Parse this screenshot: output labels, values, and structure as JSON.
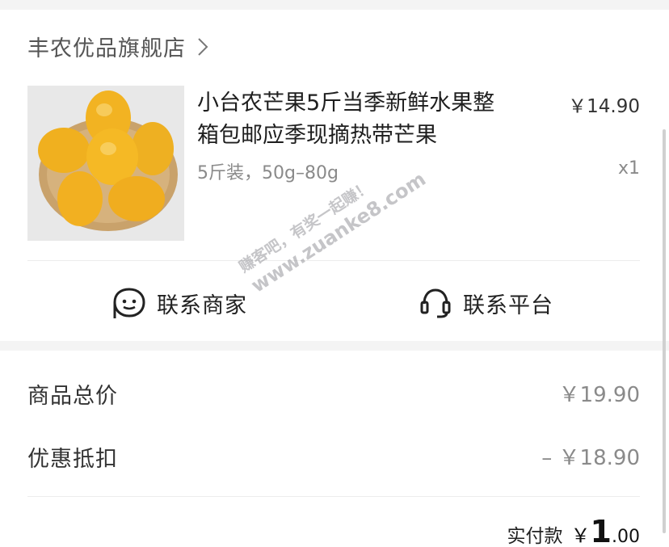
{
  "store": {
    "name": "丰农优品旗舰店"
  },
  "product": {
    "image": "mango-product-photo",
    "title_line1": "小台农芒果5斤当季新鲜水果整",
    "title_line2": "箱包邮应季现摘热带芒果",
    "spec": "5斤装，50g–80g",
    "price": "￥14.90",
    "qty": "x1"
  },
  "actions": {
    "contact_merchant": "联系商家",
    "contact_platform": "联系平台"
  },
  "summary": {
    "total_label": "商品总价",
    "total_value": "￥19.90",
    "discount_label": "优惠抵扣",
    "discount_value": "– ￥18.90",
    "paid_label": "实付款",
    "paid_currency": "￥",
    "paid_integer": "1",
    "paid_decimal": ".00"
  },
  "watermark": {
    "line1": "赚客吧，有奖一起赚！",
    "line2": "www.zuanke8.com"
  },
  "colors": {
    "page_bg": "#f4f4f4",
    "card_bg": "#ffffff",
    "text_primary": "#222222",
    "text_secondary": "#8a8a8a",
    "mango": "#f2b322"
  },
  "icons": {
    "store_chevron": "chevron-right-icon",
    "merchant": "smiley-chat-icon",
    "platform": "headset-icon"
  }
}
